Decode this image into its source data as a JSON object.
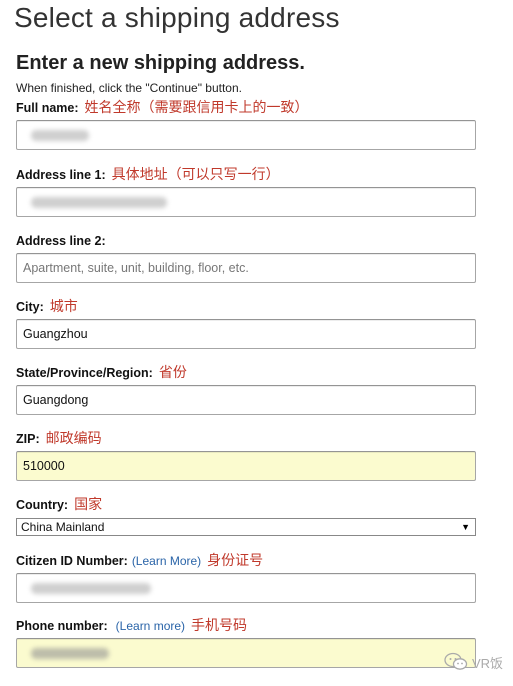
{
  "header": {
    "title": "Select a shipping address"
  },
  "form": {
    "heading": "Enter a new shipping address.",
    "instructions": "When finished, click the \"Continue\" button.",
    "full_name": {
      "label": "Full name:",
      "note": "姓名全称（需要跟信用卡上的一致）",
      "value": ""
    },
    "address_line1": {
      "label": "Address line 1:",
      "note": "具体地址（可以只写一行）",
      "value": ""
    },
    "address_line2": {
      "label": "Address line 2:",
      "placeholder": "Apartment, suite, unit, building, floor, etc."
    },
    "city": {
      "label": "City:",
      "note": "城市",
      "value": "Guangzhou"
    },
    "state": {
      "label": "State/Province/Region:",
      "note": "省份",
      "value": "Guangdong"
    },
    "zip": {
      "label": "ZIP:",
      "note": "邮政编码",
      "value": "510000"
    },
    "country": {
      "label": "Country:",
      "note": "国家",
      "selected": "China Mainland"
    },
    "citizen_id": {
      "label": "Citizen ID Number:",
      "learn_more": "(Learn More)",
      "note": "身份证号",
      "value": ""
    },
    "phone": {
      "label": "Phone number:",
      "learn_more": "(Learn more)",
      "note": "手机号码",
      "value": ""
    }
  },
  "watermark": {
    "text": "VR饭"
  },
  "colors": {
    "annotation": "#c0392b",
    "link": "#2a64a8",
    "autofill": "#fbfbcf"
  }
}
